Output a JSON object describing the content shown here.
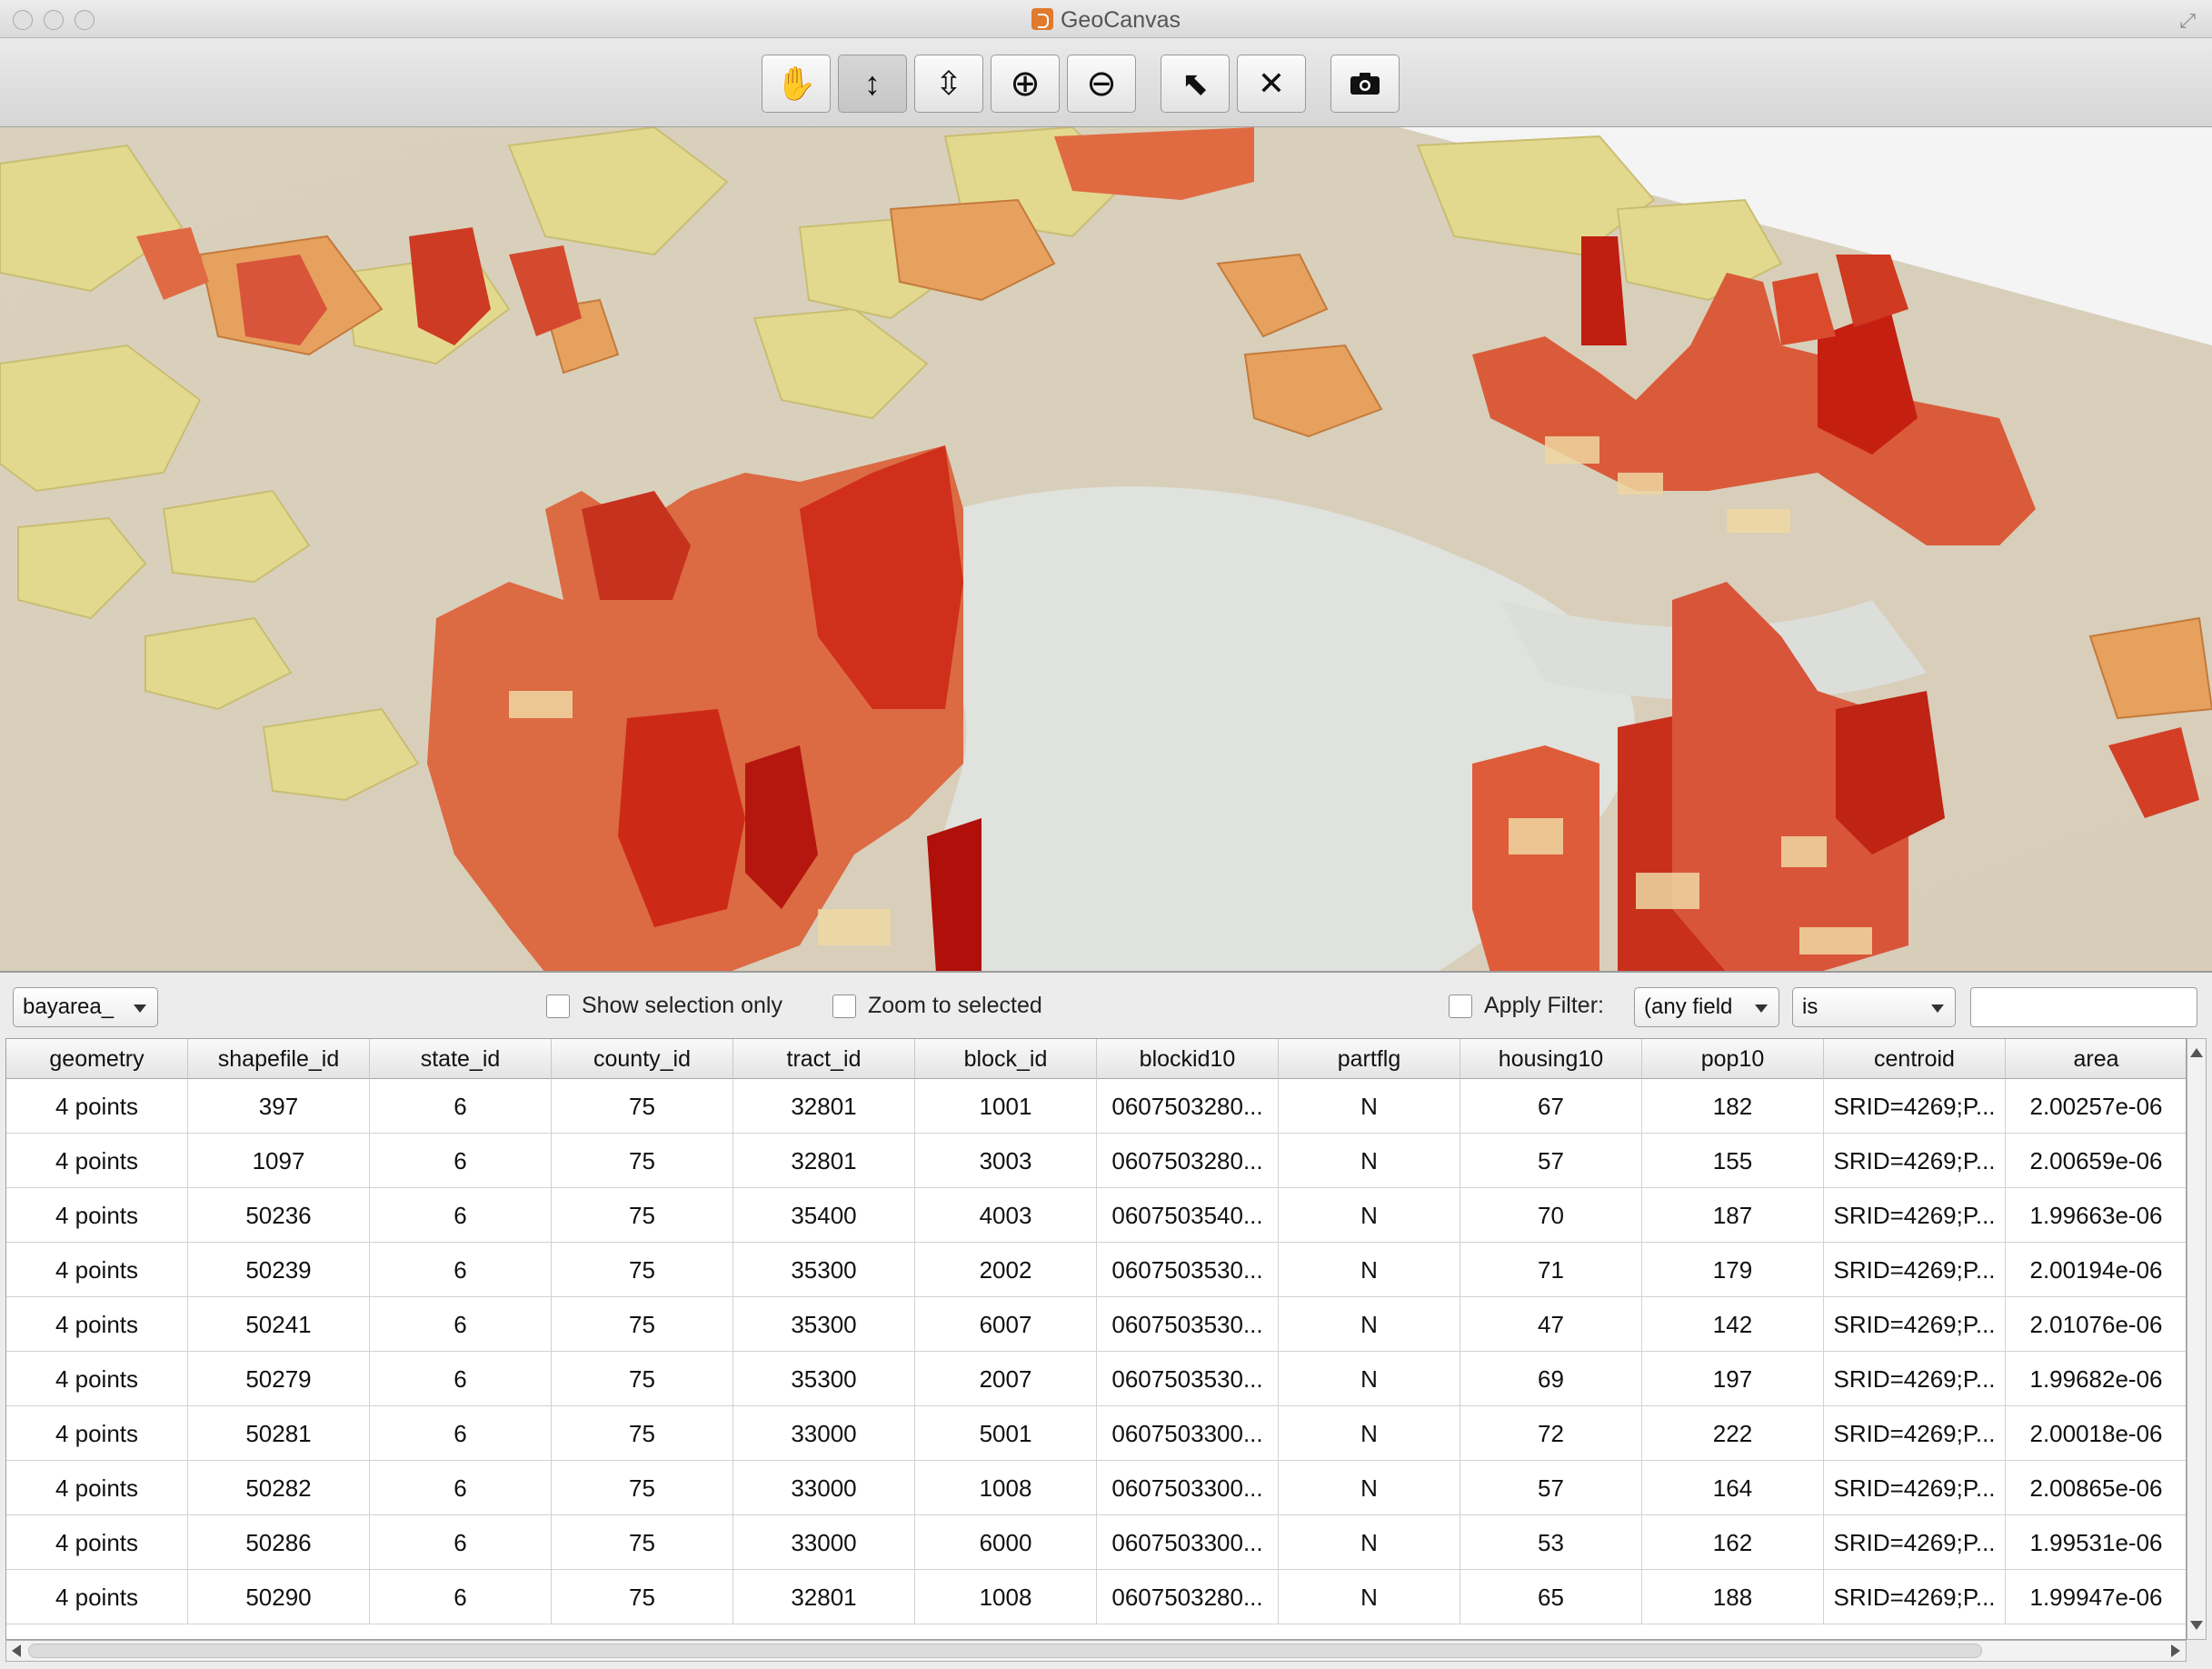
{
  "window": {
    "title": "GeoCanvas",
    "colors": {
      "accent_red": "#cc2a17",
      "mid_orange": "#e1793f",
      "pale_yellow": "#e2d78c",
      "water": "#dde0dd"
    }
  },
  "toolbar": {
    "buttons": [
      {
        "icon": "hand-pan-icon",
        "glyph": "✋",
        "active": false
      },
      {
        "icon": "vertical-move-icon",
        "glyph": "↕",
        "active": true
      },
      {
        "icon": "tilt-icon",
        "glyph": "⇧",
        "active": false
      },
      {
        "icon": "zoom-in-icon",
        "glyph": "⊕",
        "active": false
      },
      {
        "icon": "zoom-out-icon",
        "glyph": "⊖",
        "active": false
      },
      {
        "icon": "select-icon",
        "glyph": "⬉",
        "active": false
      },
      {
        "icon": "clear-selection-icon",
        "glyph": "✕",
        "active": false
      },
      {
        "icon": "camera-icon",
        "glyph": "📷",
        "active": false
      }
    ]
  },
  "controls": {
    "layer_select": "bayarea_",
    "show_selection_only": "Show selection only",
    "zoom_to_selected": "Zoom to selected",
    "apply_filter": "Apply Filter:",
    "field_select": "(any field",
    "operator_select": "is",
    "filter_value": ""
  },
  "table": {
    "columns": [
      "geometry",
      "shapefile_id",
      "state_id",
      "county_id",
      "tract_id",
      "block_id",
      "blockid10",
      "partflg",
      "housing10",
      "pop10",
      "centroid",
      "area"
    ],
    "rows": [
      [
        "4 points",
        "397",
        "6",
        "75",
        "32801",
        "1001",
        "0607503280...",
        "N",
        "67",
        "182",
        "SRID=4269;P...",
        "2.00257e-06"
      ],
      [
        "4 points",
        "1097",
        "6",
        "75",
        "32801",
        "3003",
        "0607503280...",
        "N",
        "57",
        "155",
        "SRID=4269;P...",
        "2.00659e-06"
      ],
      [
        "4 points",
        "50236",
        "6",
        "75",
        "35400",
        "4003",
        "0607503540...",
        "N",
        "70",
        "187",
        "SRID=4269;P...",
        "1.99663e-06"
      ],
      [
        "4 points",
        "50239",
        "6",
        "75",
        "35300",
        "2002",
        "0607503530...",
        "N",
        "71",
        "179",
        "SRID=4269;P...",
        "2.00194e-06"
      ],
      [
        "4 points",
        "50241",
        "6",
        "75",
        "35300",
        "6007",
        "0607503530...",
        "N",
        "47",
        "142",
        "SRID=4269;P...",
        "2.01076e-06"
      ],
      [
        "4 points",
        "50279",
        "6",
        "75",
        "35300",
        "2007",
        "0607503530...",
        "N",
        "69",
        "197",
        "SRID=4269;P...",
        "1.99682e-06"
      ],
      [
        "4 points",
        "50281",
        "6",
        "75",
        "33000",
        "5001",
        "0607503300...",
        "N",
        "72",
        "222",
        "SRID=4269;P...",
        "2.00018e-06"
      ],
      [
        "4 points",
        "50282",
        "6",
        "75",
        "33000",
        "1008",
        "0607503300...",
        "N",
        "57",
        "164",
        "SRID=4269;P...",
        "2.00865e-06"
      ],
      [
        "4 points",
        "50286",
        "6",
        "75",
        "33000",
        "6000",
        "0607503300...",
        "N",
        "53",
        "162",
        "SRID=4269;P...",
        "1.99531e-06"
      ],
      [
        "4 points",
        "50290",
        "6",
        "75",
        "32801",
        "1008",
        "0607503280...",
        "N",
        "65",
        "188",
        "SRID=4269;P...",
        "1.99947e-06"
      ]
    ]
  }
}
